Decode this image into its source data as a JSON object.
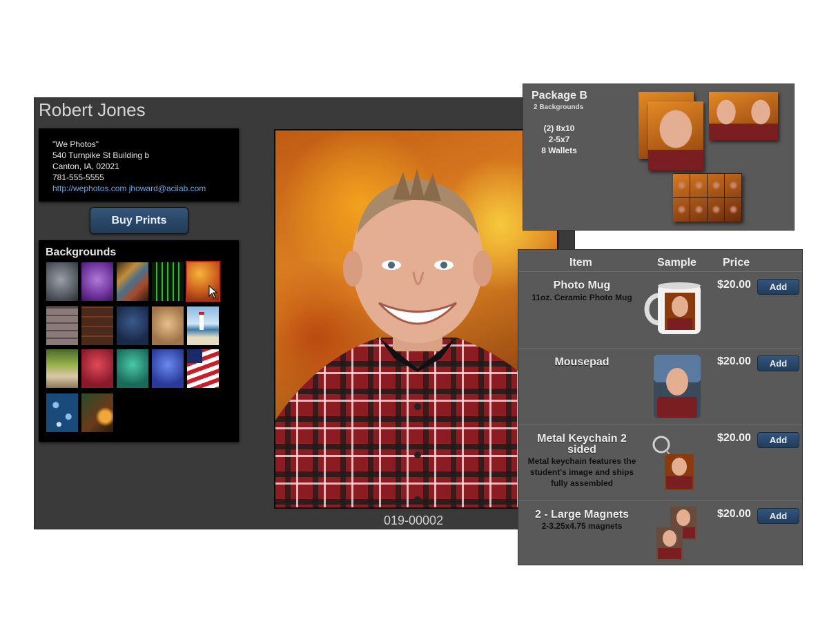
{
  "student": {
    "name": "Robert Jones"
  },
  "studio": {
    "name": "\"We Photos\"",
    "address1": "540 Turnpike St Building b",
    "address2": "Canton, IA, 02021",
    "phone": "781-555-5555",
    "website": "http://wephotos.com",
    "email": "jhoward@acilab.com"
  },
  "actions": {
    "buy_prints": "Buy Prints"
  },
  "backgrounds": {
    "title": "Backgrounds",
    "selected_index": 4
  },
  "image_code": "019-00002",
  "package": {
    "title": "Package B",
    "subtitle": "2 Backgrounds",
    "items": [
      "(2) 8x10",
      "2-5x7",
      "8 Wallets"
    ]
  },
  "products": {
    "headers": {
      "item": "Item",
      "sample": "Sample",
      "price": "Price"
    },
    "add_label": "Add",
    "rows": [
      {
        "name": "Photo Mug",
        "description": "11oz. Ceramic Photo Mug",
        "price": "$20.00"
      },
      {
        "name": "Mousepad",
        "description": "",
        "price": "$20.00"
      },
      {
        "name": "Metal Keychain 2 sided",
        "description": "Metal keychain features the student's image and ships fully assembled",
        "price": "$20.00"
      },
      {
        "name": "2 - Large Magnets",
        "description": "2-3.25x4.75 magnets",
        "price": "$20.00"
      }
    ]
  },
  "colors": {
    "accent_button": "#2b4a6d",
    "selected_border": "#d21f1f",
    "link": "#6aa9e8"
  }
}
